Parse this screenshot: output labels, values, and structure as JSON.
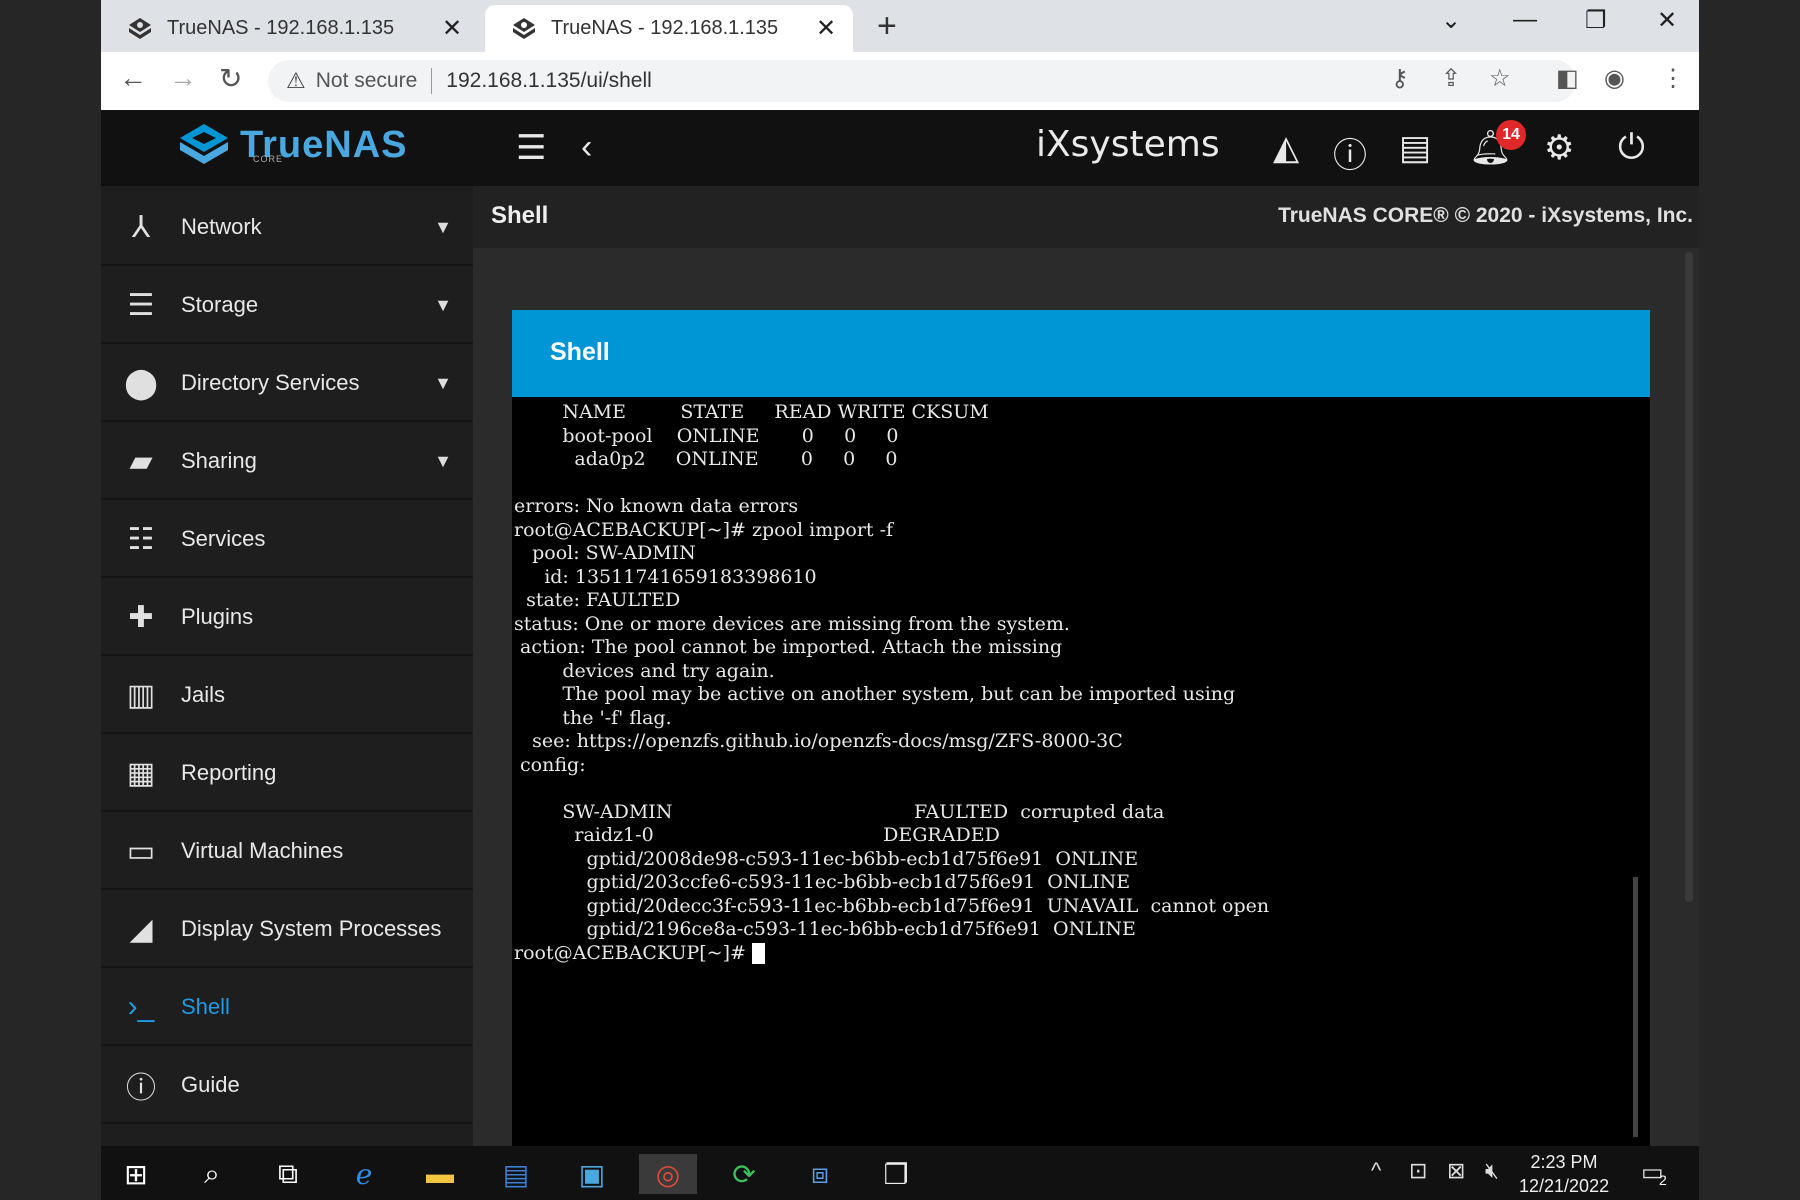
{
  "browser": {
    "tabs": [
      {
        "title": "TrueNAS - 192.168.1.135",
        "active": false
      },
      {
        "title": "TrueNAS - 192.168.1.135",
        "active": true
      }
    ],
    "new_tab": "+",
    "security_label": "Not secure",
    "url": "192.168.1.135/ui/shell"
  },
  "app": {
    "logo_text": "TrueNAS",
    "logo_sub": "CORE",
    "vendor": "iXsystems",
    "notification_count": "14",
    "page_title": "Shell",
    "copyright": "TrueNAS CORE® © 2020 - iXsystems, Inc.",
    "card_title": "Shell"
  },
  "sidebar": {
    "items": [
      {
        "label": "Network",
        "icon": "network-icon",
        "has_caret": true
      },
      {
        "label": "Storage",
        "icon": "storage-icon",
        "has_caret": true
      },
      {
        "label": "Directory Services",
        "icon": "directory-services-icon",
        "has_caret": true
      },
      {
        "label": "Sharing",
        "icon": "sharing-icon",
        "has_caret": true
      },
      {
        "label": "Services",
        "icon": "services-icon",
        "has_caret": false
      },
      {
        "label": "Plugins",
        "icon": "plugins-icon",
        "has_caret": false
      },
      {
        "label": "Jails",
        "icon": "jails-icon",
        "has_caret": false
      },
      {
        "label": "Reporting",
        "icon": "reporting-icon",
        "has_caret": false
      },
      {
        "label": "Virtual Machines",
        "icon": "virtual-machines-icon",
        "has_caret": false
      },
      {
        "label": "Display System Processes",
        "icon": "processes-icon",
        "has_caret": false
      },
      {
        "label": "Shell",
        "icon": "shell-icon",
        "has_caret": false,
        "active": true
      },
      {
        "label": "Guide",
        "icon": "guide-icon",
        "has_caret": false
      }
    ]
  },
  "terminal": {
    "lines": [
      "        NAME         STATE     READ WRITE CKSUM",
      "        boot-pool    ONLINE       0     0     0",
      "          ada0p2     ONLINE       0     0     0",
      "",
      "errors: No known data errors",
      "root@ACEBACKUP[~]# zpool import -f",
      "   pool: SW-ADMIN",
      "     id: 13511741659183398610",
      "  state: FAULTED",
      "status: One or more devices are missing from the system.",
      " action: The pool cannot be imported. Attach the missing",
      "        devices and try again.",
      "        The pool may be active on another system, but can be imported using",
      "        the '-f' flag.",
      "   see: https://openzfs.github.io/openzfs-docs/msg/ZFS-8000-3C",
      " config:",
      "",
      "        SW-ADMIN                                        FAULTED  corrupted data",
      "          raidz1-0                                      DEGRADED",
      "            gptid/2008de98-c593-11ec-b6bb-ecb1d75f6e91  ONLINE",
      "            gptid/203ccfe6-c593-11ec-b6bb-ecb1d75f6e91  ONLINE",
      "            gptid/20decc3f-c593-11ec-b6bb-ecb1d75f6e91  UNAVAIL  cannot open",
      "            gptid/2196ce8a-c593-11ec-b6bb-ecb1d75f6e91  ONLINE"
    ],
    "prompt": "root@ACEBACKUP[~]# "
  },
  "taskbar": {
    "time": "2:23 PM",
    "date": "12/21/2022",
    "notification_count": "2"
  },
  "colors": {
    "accent": "#0095d5",
    "active_nav": "#1e9be4",
    "badge": "#e02828"
  }
}
